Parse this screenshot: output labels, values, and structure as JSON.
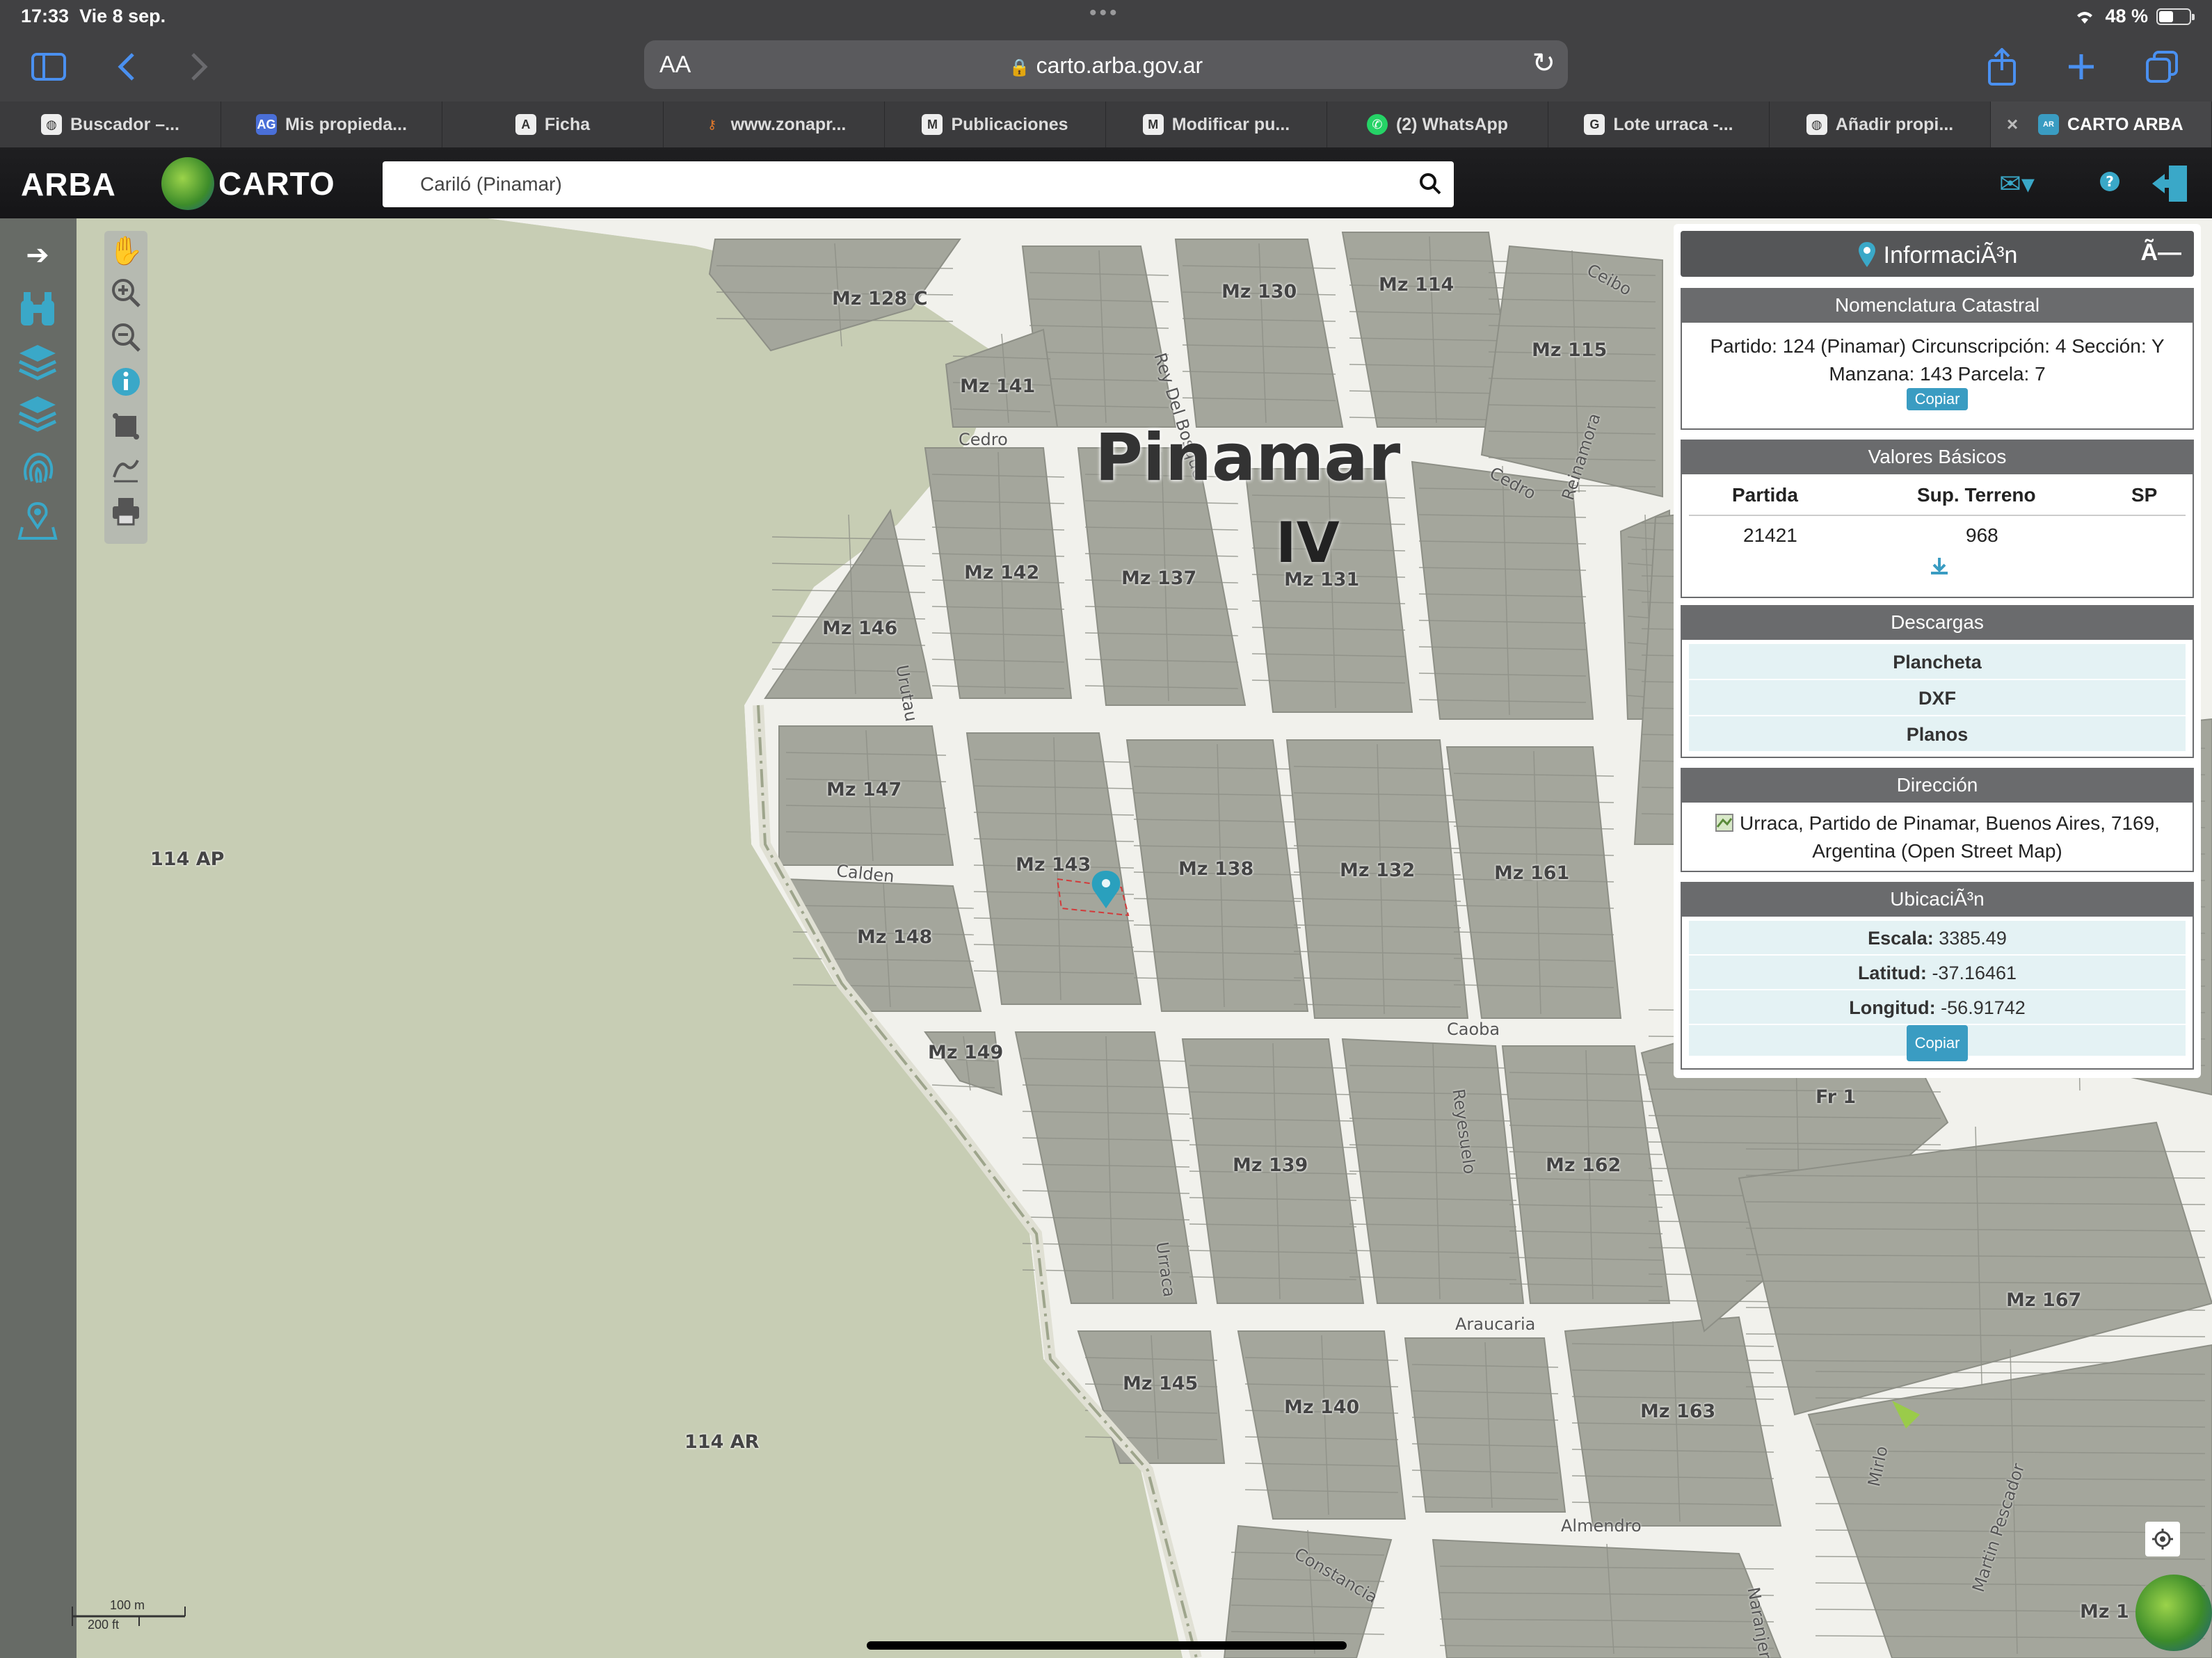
{
  "status": {
    "time": "17:33",
    "date": "Vie 8 sep.",
    "battery": "48 %",
    "battery_level": 0.48
  },
  "browser": {
    "aa_label": "AA",
    "url": "carto.arba.gov.ar",
    "tabs": [
      {
        "label": "Buscador –...",
        "icon": "globe-icon"
      },
      {
        "label": "Mis propieda...",
        "icon": "AG"
      },
      {
        "label": "Ficha",
        "icon": "A"
      },
      {
        "label": "www.zonapr...",
        "icon": "key-icon"
      },
      {
        "label": "Publicaciones",
        "icon": "M"
      },
      {
        "label": "Modificar pu...",
        "icon": "M"
      },
      {
        "label": "(2) WhatsApp",
        "icon": "whatsapp-icon"
      },
      {
        "label": "Lote urraca -...",
        "icon": "G"
      },
      {
        "label": "Añadir propi...",
        "icon": "globe-icon"
      },
      {
        "label": "CARTO ARBA",
        "icon": "ARBA"
      }
    ]
  },
  "app": {
    "arba_logo": "ARBA",
    "carto_logo": "CARTO",
    "search_value": "Cariló (Pinamar)"
  },
  "map": {
    "title": "Pinamar",
    "subtitle": "IV",
    "blocks": [
      {
        "label": "Mz 128 C"
      },
      {
        "label": "Mz 130"
      },
      {
        "label": "Mz 114"
      },
      {
        "label": "Mz 115"
      },
      {
        "label": "Mz 141"
      },
      {
        "label": "Mz 142"
      },
      {
        "label": "Mz 137"
      },
      {
        "label": "Mz 131"
      },
      {
        "label": "Mz 146"
      },
      {
        "label": "Mz 147"
      },
      {
        "label": "Mz 143"
      },
      {
        "label": "Mz 138"
      },
      {
        "label": "Mz 132"
      },
      {
        "label": "Mz 161"
      },
      {
        "label": "Mz 148"
      },
      {
        "label": "Mz 149"
      },
      {
        "label": "Mz 139"
      },
      {
        "label": "Mz 162"
      },
      {
        "label": "Mz 145"
      },
      {
        "label": "Mz 140"
      },
      {
        "label": "Mz 163"
      },
      {
        "label": "Mz 167"
      },
      {
        "label": "Fr 1"
      },
      {
        "label": "114 AP"
      },
      {
        "label": "114 AR"
      },
      {
        "label": "Mz 1"
      }
    ],
    "streets": [
      "Cedro",
      "Rey Del Bosque",
      "Cedro",
      "Reinamora",
      "Ceibo",
      "Urutau",
      "Calden",
      "Caoba",
      "Reyesuelo",
      "Urraca",
      "Araucaria",
      "Almendro",
      "Constancia",
      "Naranjero",
      "Mirlo",
      "Martin Pescador"
    ],
    "scale_m": "100 m",
    "scale_ft": "200 ft"
  },
  "info": {
    "title": "InformaciÃ³n",
    "close": "Ã—",
    "nomenclatura": {
      "heading": "Nomenclatura Catastral",
      "line1": "Partido: 124 (Pinamar) Circunscripción: 4 Sección: Y",
      "line2": "Manzana: 143 Parcela: 7",
      "copy": "Copiar"
    },
    "valores": {
      "heading": "Valores Básicos",
      "col_partida": "Partida",
      "col_sup": "Sup. Terreno",
      "col_sp": "SP",
      "partida": "21421",
      "sup": "968"
    },
    "descargas": {
      "heading": "Descargas",
      "items": [
        "Plancheta",
        "DXF",
        "Planos"
      ]
    },
    "direccion": {
      "heading": "Dirección",
      "line1": "Urraca, Partido de Pinamar, Buenos Aires, 7169,",
      "line2": "Argentina (Open Street Map)"
    },
    "ubicacion": {
      "heading": "UbicaciÃ³n",
      "escala_label": "Escala:",
      "escala": "3385.49",
      "lat_label": "Latitud:",
      "lat": "-37.16461",
      "lon_label": "Longitud:",
      "lon": "-56.91742",
      "copy": "Copiar"
    }
  },
  "colors": {
    "accent": "#3a9cc2",
    "section_head": "#6a6b6d",
    "map_bg": "#c5cbb4",
    "block": "#a4a69c"
  }
}
